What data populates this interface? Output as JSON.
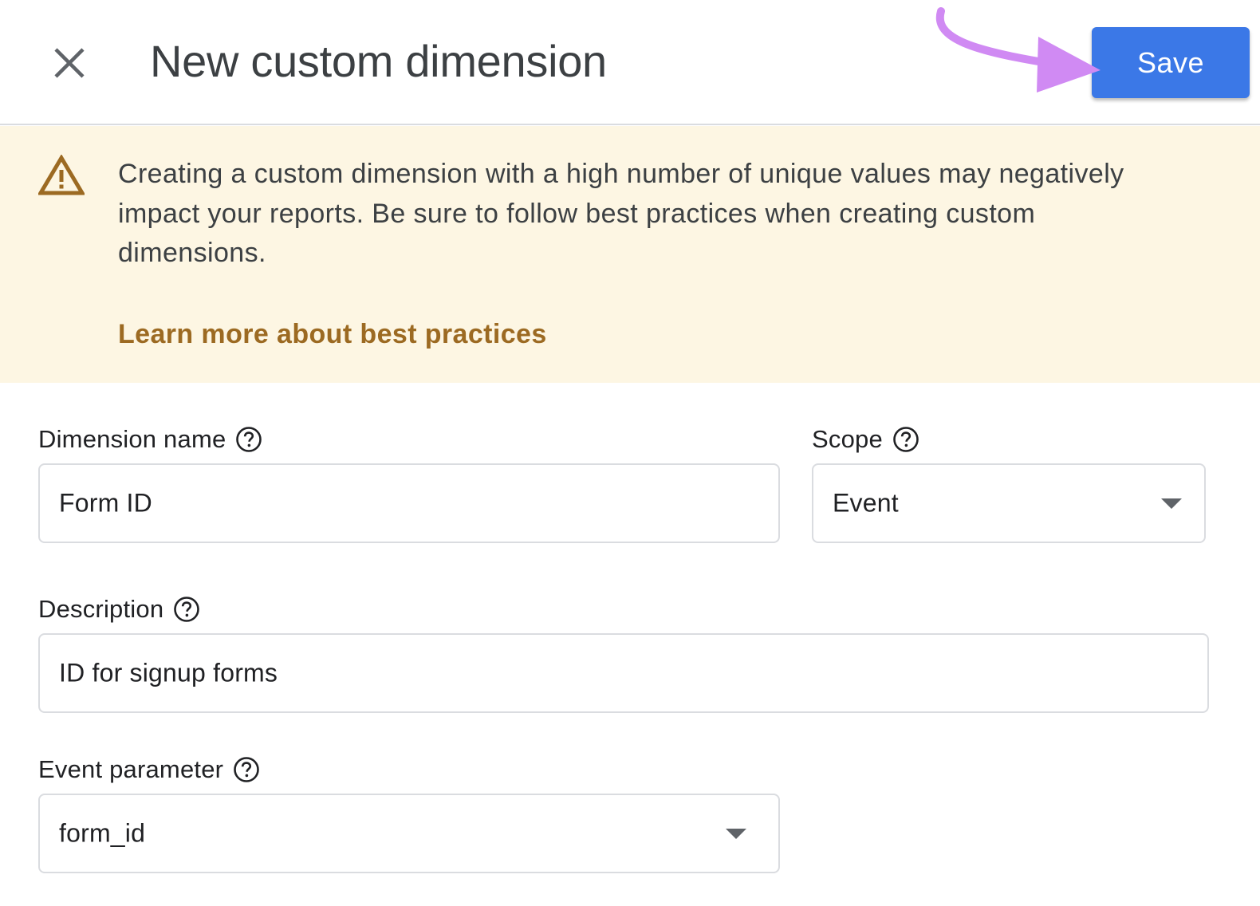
{
  "header": {
    "title": "New custom dimension",
    "save_label": "Save"
  },
  "banner": {
    "icon": "warning-icon",
    "message": "Creating a custom dimension with a high number of unique values may negatively impact your reports. Be sure to follow best practices when creating custom dimensions.",
    "link_text": "Learn more about best practices"
  },
  "form": {
    "dimension_name": {
      "label": "Dimension name",
      "value": "Form ID"
    },
    "scope": {
      "label": "Scope",
      "value": "Event"
    },
    "description": {
      "label": "Description",
      "value": "ID for signup forms"
    },
    "event_parameter": {
      "label": "Event parameter",
      "value": "form_id"
    }
  },
  "colors": {
    "save_button": "#3b78e7",
    "banner_background": "#fdf6e3",
    "banner_link": "#9c6a22",
    "annotation_arrow": "#d08af3"
  }
}
